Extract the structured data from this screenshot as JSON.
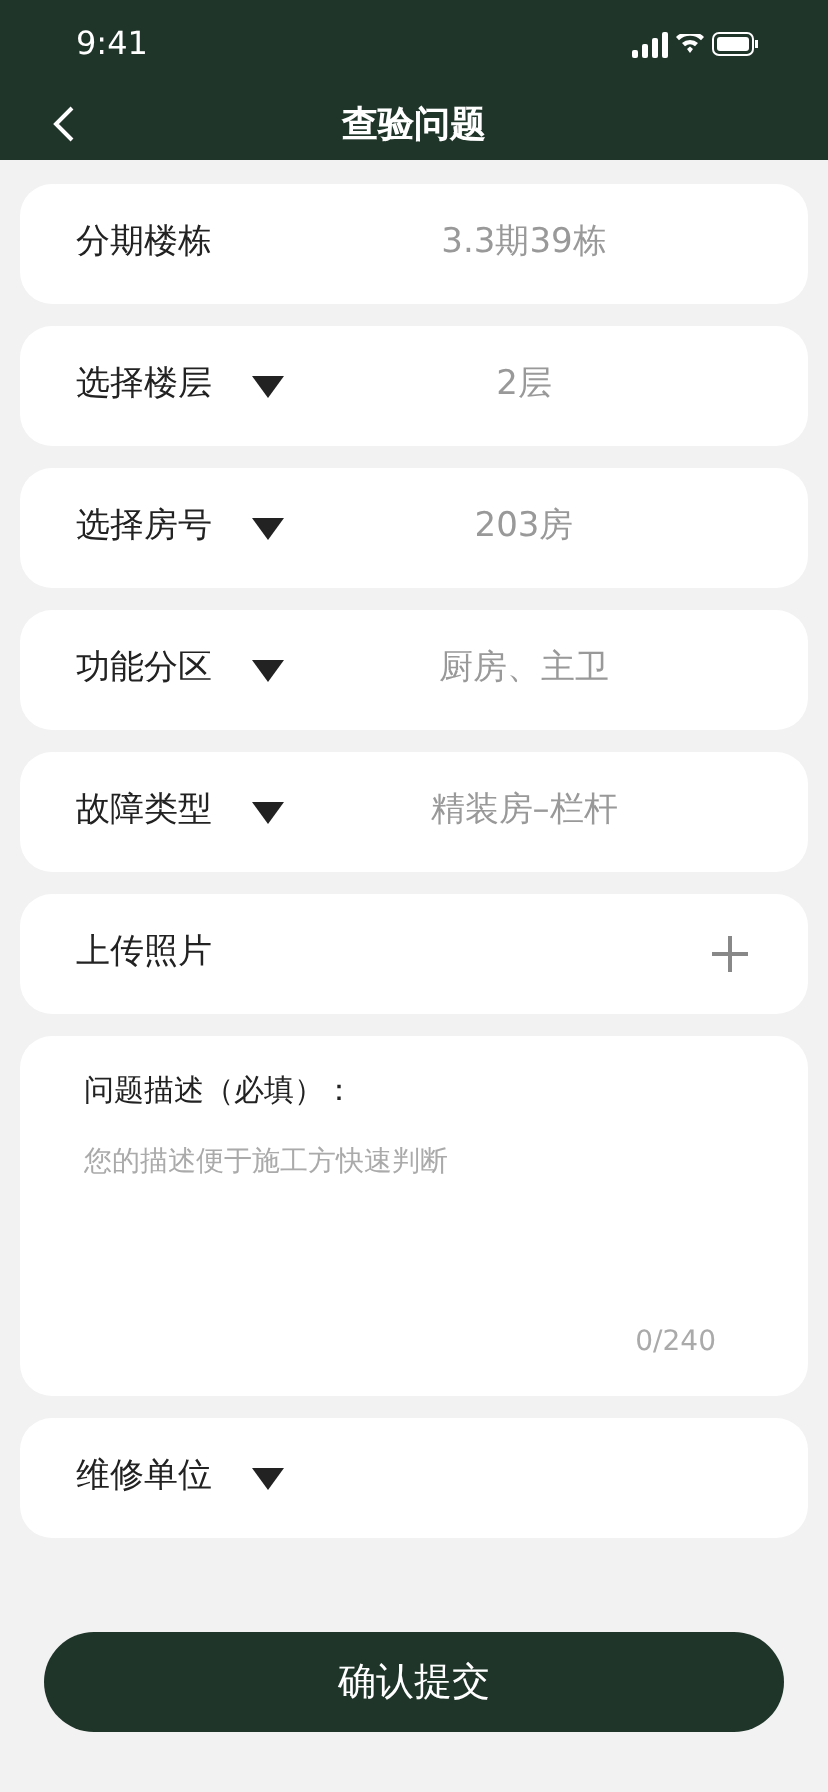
{
  "status_bar": {
    "time": "9:41"
  },
  "nav": {
    "title": "查验问题"
  },
  "sections": [
    {
      "kind": "static",
      "label": "分期楼栋",
      "value": "3.3期39栋"
    },
    {
      "kind": "dropdown",
      "label": "选择楼层",
      "value": "2层"
    },
    {
      "kind": "dropdown",
      "label": "选择房号",
      "value": "203房"
    },
    {
      "kind": "dropdown",
      "label": "功能分区",
      "value": "厨房、主卫"
    },
    {
      "kind": "dropdown",
      "label": "故障类型",
      "value": "精装房–栏杆"
    },
    {
      "kind": "upload",
      "label": "上传照片"
    },
    {
      "kind": "textarea",
      "label": "问题描述（必填）：",
      "placeholder": "您的描述便于施工方快速判断",
      "counter": "0/240"
    },
    {
      "kind": "dropdown",
      "label": "维修单位"
    }
  ],
  "submit": {
    "label": "确认提交"
  }
}
